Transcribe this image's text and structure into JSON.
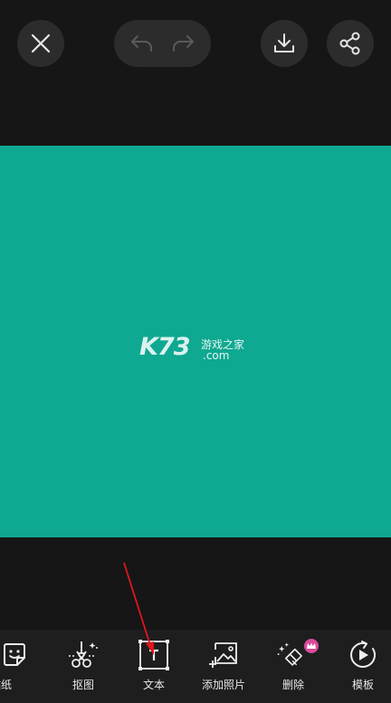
{
  "header": {
    "close_icon": "close-icon",
    "undo_icon": "undo-icon",
    "redo_icon": "redo-icon",
    "download_icon": "download-icon",
    "share_icon": "share-icon"
  },
  "canvas": {
    "background": "#0fa891",
    "watermark": {
      "brand": "K73",
      "tagline": "游戏之家",
      "domain": ".com"
    }
  },
  "toolbar": {
    "items": [
      {
        "label": "贴纸",
        "icon": "sticker-icon"
      },
      {
        "label": "抠图",
        "icon": "cutout-icon"
      },
      {
        "label": "文本",
        "icon": "text-icon"
      },
      {
        "label": "添加照片",
        "icon": "add-photo-icon"
      },
      {
        "label": "删除",
        "icon": "eraser-icon"
      },
      {
        "label": "模板",
        "icon": "template-icon"
      }
    ]
  },
  "colors": {
    "background": "#161616",
    "button_bg": "#2c2c2c",
    "toolbar_bg": "#1e1e1e",
    "accent_arrow": "#e0161e",
    "badge": "#d94b9a"
  }
}
